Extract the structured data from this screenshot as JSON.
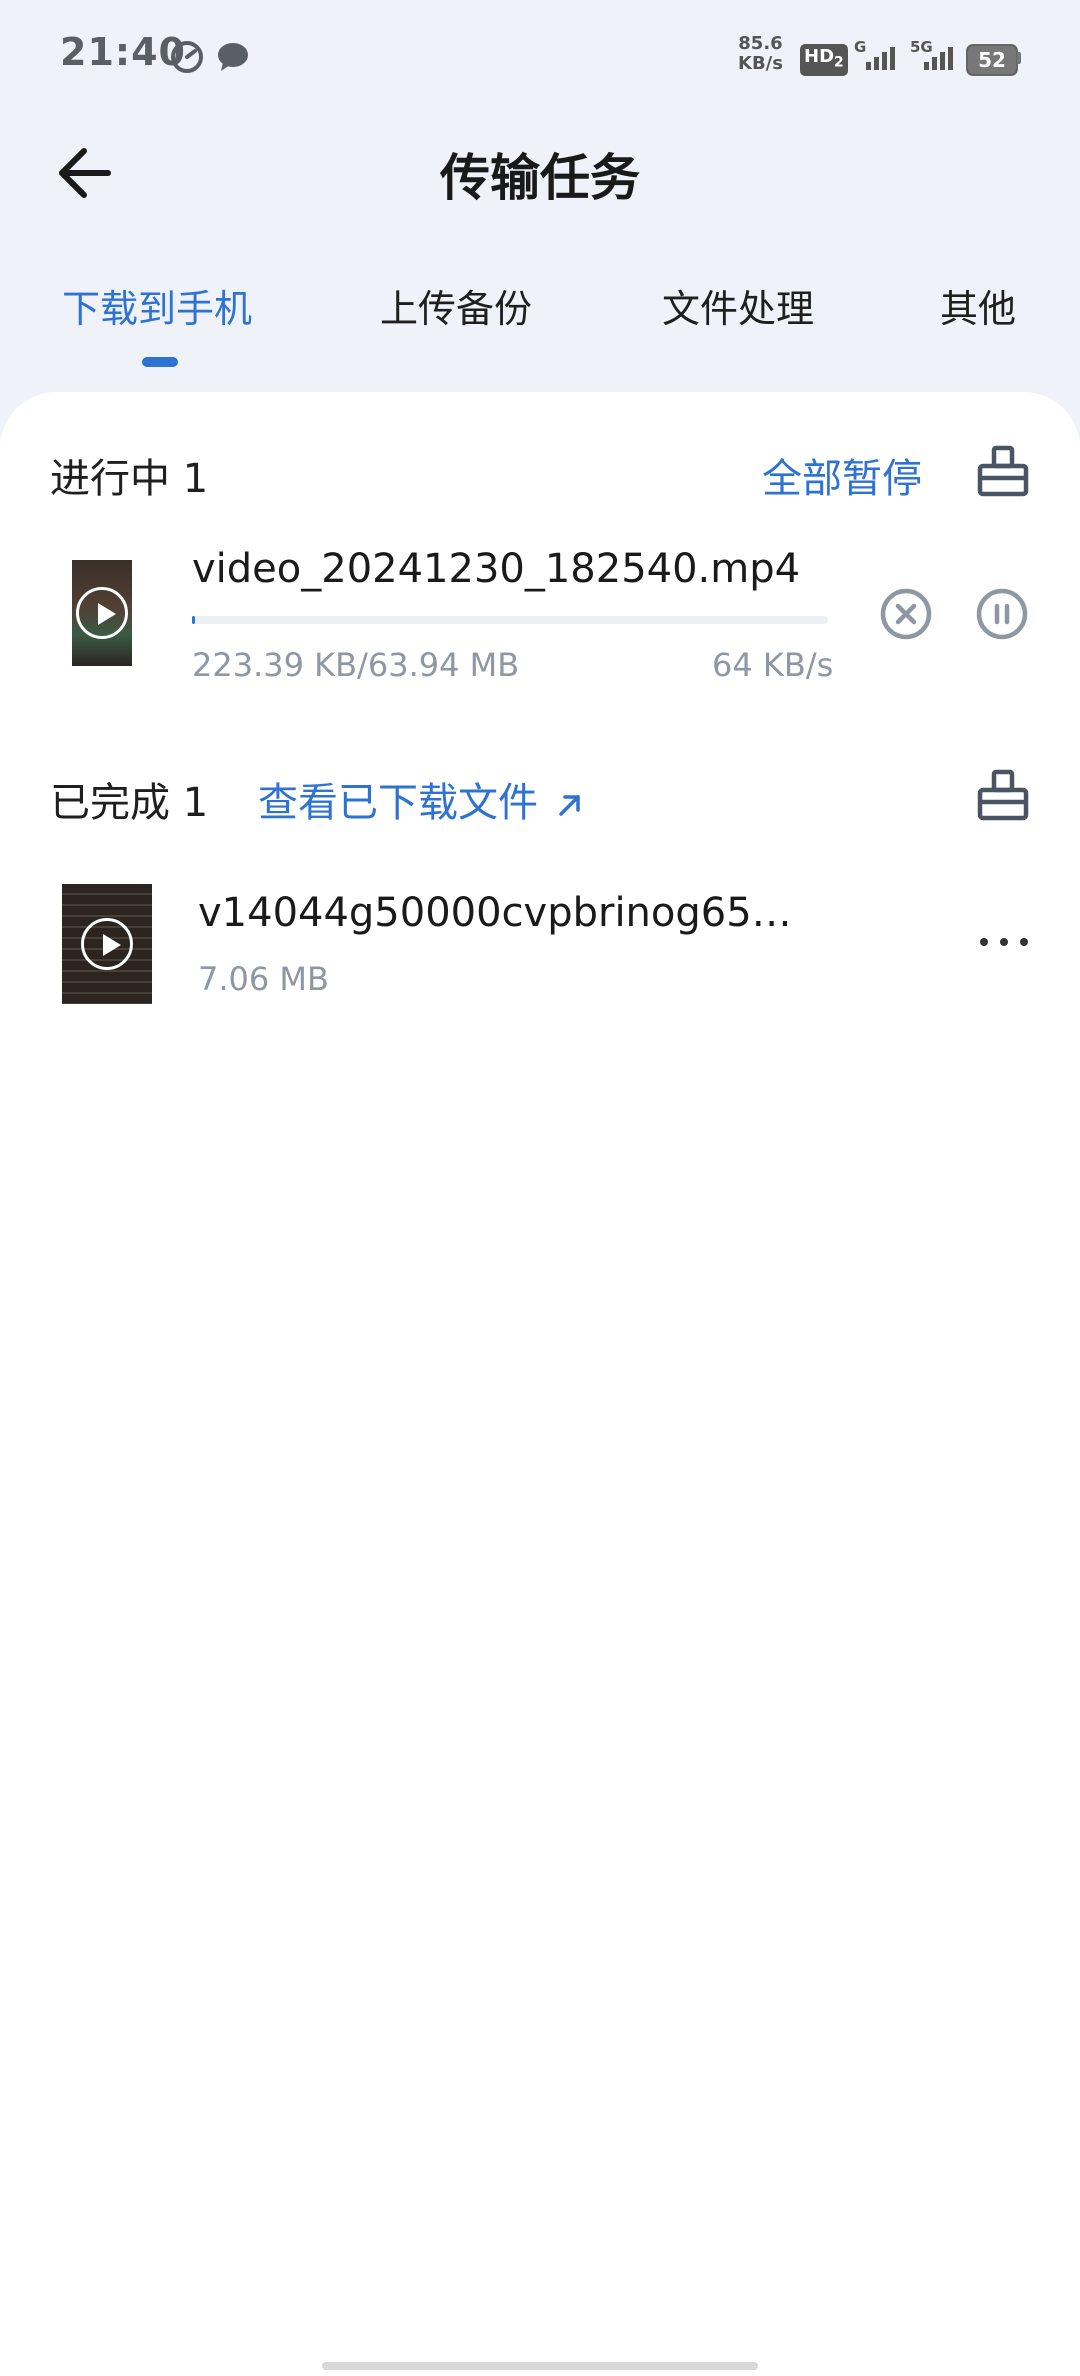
{
  "status_bar": {
    "time": "21:40",
    "net_speed_value": "85.6",
    "net_speed_unit": "KB/s",
    "hd_label": "HD",
    "hd_sub": "2",
    "sig1_label": "G",
    "sig2_label": "5G",
    "battery": "52",
    "icons": [
      "speed-gauge-icon",
      "chat-bubble-icon",
      "signal-icon",
      "battery-icon"
    ]
  },
  "header": {
    "title": "传输任务"
  },
  "tabs": [
    {
      "label": "下载到手机",
      "active": true
    },
    {
      "label": "上传备份",
      "active": false
    },
    {
      "label": "文件处理",
      "active": false
    },
    {
      "label": "其他",
      "active": false
    }
  ],
  "in_progress": {
    "title": "进行中 1",
    "pause_all_label": "全部暂停",
    "items": [
      {
        "name": "video_20241230_182540.mp4",
        "progress_text": "223.39 KB/63.94 MB",
        "speed": "64 KB/s",
        "progress_fraction": 0.0035
      }
    ]
  },
  "completed": {
    "title": "已完成 1",
    "view_link_label": "查看已下载文件",
    "items": [
      {
        "name": "v14044g50000cvpbrinog65…",
        "size": "7.06 MB"
      }
    ]
  },
  "colors": {
    "accent": "#2f73d2",
    "bg": "#eff3f9",
    "muted": "#8e97a3"
  }
}
